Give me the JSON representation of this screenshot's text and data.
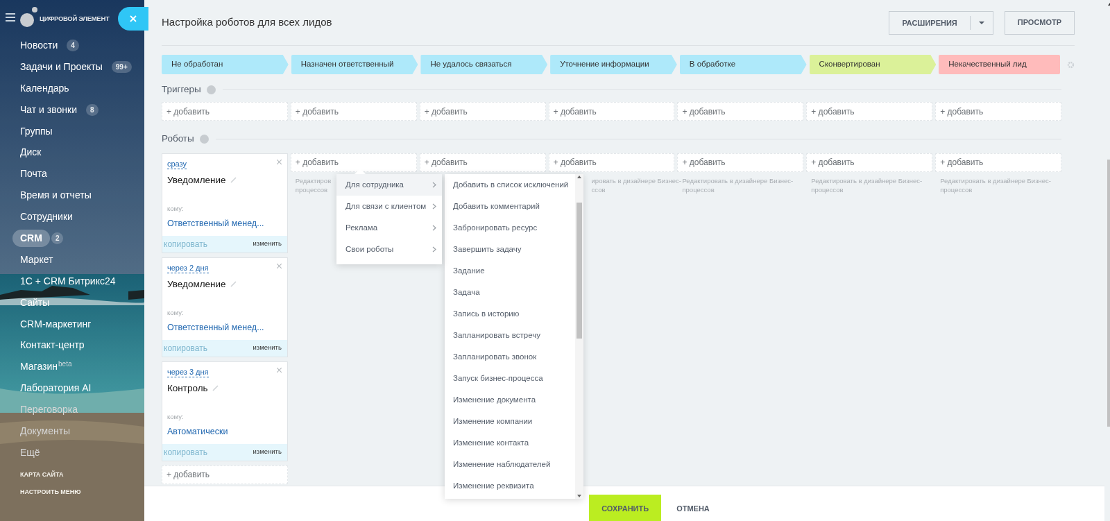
{
  "sidebar": {
    "logo": "ЦИФРОВОЙ ЭЛЕМЕНТ",
    "items": [
      {
        "label": "Новости",
        "count": "4",
        "selected": false
      },
      {
        "label": "Задачи и Проекты",
        "count": "99+",
        "selected": false
      },
      {
        "label": "Календарь",
        "selected": false
      },
      {
        "label": "Чат и звонки",
        "count": "8",
        "selected": false
      },
      {
        "label": "Группы",
        "selected": false
      },
      {
        "label": "Диск",
        "selected": false
      },
      {
        "label": "Почта",
        "selected": false
      },
      {
        "label": "Время и отчеты",
        "selected": false
      },
      {
        "label": "Сотрудники",
        "selected": false
      },
      {
        "label": "CRM",
        "count": "2",
        "selected": true
      },
      {
        "label": "Маркет",
        "selected": false
      },
      {
        "label": "1С + CRM Битрикс24",
        "selected": false
      },
      {
        "label": "Сайты",
        "selected": false
      },
      {
        "label": "CRM-маркетинг",
        "selected": false
      },
      {
        "label": "Контакт-центр",
        "selected": false
      },
      {
        "label": "Магазин",
        "sup": "beta",
        "selected": false
      },
      {
        "label": "Лаборатория AI",
        "selected": false
      },
      {
        "label": "Переговорка",
        "selected": false
      },
      {
        "label": "Документы",
        "selected": false
      },
      {
        "label": "Ещё",
        "selected": false
      }
    ],
    "footer_links": [
      "КАРТА САЙТА",
      "НАСТРОИТЬ МЕНЮ"
    ]
  },
  "header": {
    "title": "Настройка роботов для всех лидов",
    "buttons": [
      "РАСШИРЕНИЯ",
      "ПРОСМОТР"
    ]
  },
  "stages": [
    {
      "label": "Не обработан",
      "color": "#aee9fa"
    },
    {
      "label": "Назначен ответственный",
      "color": "#aee9fa"
    },
    {
      "label": "Не удалось связаться",
      "color": "#aee9fa"
    },
    {
      "label": "Уточнение информации",
      "color": "#aee9fa"
    },
    {
      "label": "В обработке",
      "color": "#aee9fa"
    },
    {
      "label": "Сконвертирован",
      "color": "#dbf199"
    },
    {
      "label": "Некачественный лид",
      "color": "#ffbbbb"
    }
  ],
  "triggers": {
    "title": "Триггеры",
    "add_buttons": [
      "+ добавить",
      "+ добавить",
      "+ добавить",
      "+ добавить",
      "+ добавить",
      "+ добавить",
      "+ добавить"
    ]
  },
  "robots": {
    "title": "Роботы",
    "columns": [
      {
        "robots": [
          {
            "delay": "сразу",
            "name": "Уведомление",
            "to_label": "кому:",
            "to": "Ответственный менед...",
            "copy": "копировать",
            "edit": "изменить"
          },
          {
            "delay": "через 2 дня",
            "name": "Уведомление",
            "to_label": "кому:",
            "to": "Ответственный менед...",
            "copy": "копировать",
            "edit": "изменить"
          },
          {
            "delay": "через 3 дня",
            "name": "Контроль",
            "to_label": "кому:",
            "to": "Автоматически",
            "copy": "копировать",
            "edit": "изменить"
          }
        ],
        "add": "+ добавить"
      },
      {
        "add": "+ добавить",
        "note_lines": [
          "Редактиров",
          "процессов"
        ]
      },
      {
        "add": "+ добавить"
      },
      {
        "add": "+ добавить",
        "note_lines": [
          "ировать в дизайнере Бизнес-",
          "ссов"
        ],
        "cut_left": true
      },
      {
        "add": "+ добавить",
        "note_lines": [
          "Редактировать в дизайнере Бизнес-",
          "процессов"
        ]
      },
      {
        "add": "+ добавить",
        "note_lines": [
          "Редактировать в дизайнере Бизнес-",
          "процессов"
        ]
      },
      {
        "add": "+ добавить",
        "note_lines": [
          "Редактировать в дизайнере Бизнес-",
          "процессов"
        ]
      }
    ]
  },
  "menu": {
    "items": [
      {
        "label": "Для сотрудника",
        "selected": true
      },
      {
        "label": "Для связи с клиентом",
        "selected": false
      },
      {
        "label": "Реклама",
        "selected": false
      },
      {
        "label": "Свои роботы",
        "selected": false
      }
    ],
    "submenu": [
      "Добавить в список исключений",
      "Добавить комментарий",
      "Забронировать ресурс",
      "Завершить задачу",
      "Задание",
      "Задача",
      "Запись в историю",
      "Запланировать встречу",
      "Запланировать звонок",
      "Запуск бизнес-процесса",
      "Изменение документа",
      "Изменение компании",
      "Изменение контакта",
      "Изменение наблюдателей",
      "Изменение реквизита"
    ]
  },
  "footer": {
    "save": "СОХРАНИТЬ",
    "cancel": "ОТМЕНА"
  }
}
